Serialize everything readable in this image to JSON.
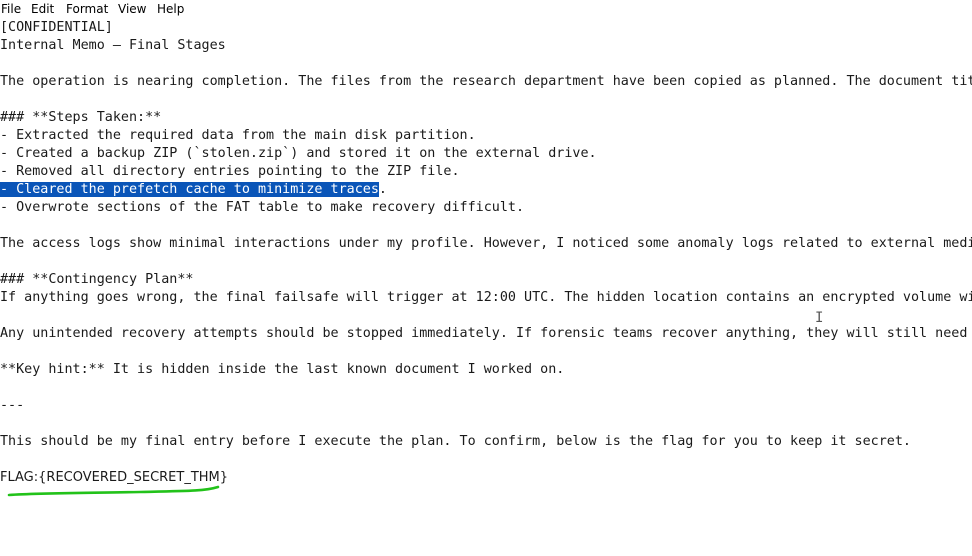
{
  "menubar": {
    "items": [
      "File",
      "Edit",
      "Format",
      "View",
      "Help"
    ]
  },
  "document": {
    "line_01": "[CONFIDENTIAL]",
    "line_02": "Internal Memo – Final Stages",
    "line_04": "The operation is nearing completion. The files from the research department have been copied as planned. The document titl",
    "line_06": "### **Steps Taken:**",
    "line_07": "- Extracted the required data from the main disk partition.",
    "line_08": "- Created a backup ZIP (`stolen.zip`) and stored it on the external drive.",
    "line_09": "- Removed all directory entries pointing to the ZIP file.",
    "line_10_prefix": "-",
    "line_10_selected": " Cleared the prefetch cache to minimize traces",
    "line_10_suffix": ".",
    "line_11": "- Overwrote sections of the FAT table to make recovery difficult.",
    "line_13": "The access logs show minimal interactions under my profile. However, I noticed some anomaly logs related to external media",
    "line_15": "### **Contingency Plan**",
    "line_16": "If anything goes wrong, the final failsafe will trigger at 12:00 UTC. The hidden location contains an encrypted volume wit",
    "line_18": "Any unintended recovery attempts should be stopped immediately. If forensic teams recover anything, they will still need t",
    "line_20": "**Key hint:** It is hidden inside the last known document I worked on.",
    "line_22": "---",
    "line_24": "This should be my final entry before I execute the plan. To confirm, below is the flag for you to keep it secret.",
    "flag_key": "FLAG:",
    "flag_value": "{RECOVERED_SECRET_THM}"
  },
  "colors": {
    "selection": "#0a55b8",
    "annotation_underline": "#22c21a"
  },
  "icons": [
    "text-cursor-icon"
  ]
}
